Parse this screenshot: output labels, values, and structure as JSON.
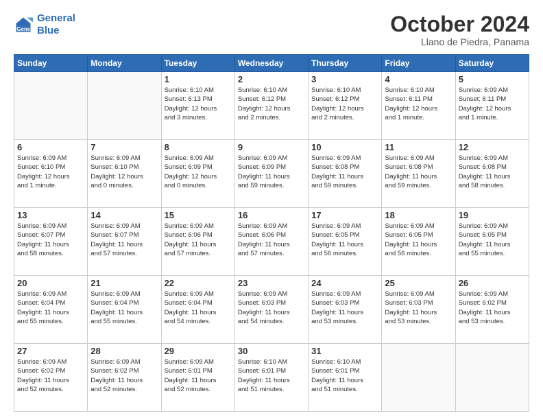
{
  "header": {
    "logo_line1": "General",
    "logo_line2": "Blue",
    "month_title": "October 2024",
    "location": "Llano de Piedra, Panama"
  },
  "weekdays": [
    "Sunday",
    "Monday",
    "Tuesday",
    "Wednesday",
    "Thursday",
    "Friday",
    "Saturday"
  ],
  "weeks": [
    [
      {
        "day": "",
        "info": ""
      },
      {
        "day": "",
        "info": ""
      },
      {
        "day": "1",
        "info": "Sunrise: 6:10 AM\nSunset: 6:13 PM\nDaylight: 12 hours\nand 3 minutes."
      },
      {
        "day": "2",
        "info": "Sunrise: 6:10 AM\nSunset: 6:12 PM\nDaylight: 12 hours\nand 2 minutes."
      },
      {
        "day": "3",
        "info": "Sunrise: 6:10 AM\nSunset: 6:12 PM\nDaylight: 12 hours\nand 2 minutes."
      },
      {
        "day": "4",
        "info": "Sunrise: 6:10 AM\nSunset: 6:11 PM\nDaylight: 12 hours\nand 1 minute."
      },
      {
        "day": "5",
        "info": "Sunrise: 6:09 AM\nSunset: 6:11 PM\nDaylight: 12 hours\nand 1 minute."
      }
    ],
    [
      {
        "day": "6",
        "info": "Sunrise: 6:09 AM\nSunset: 6:10 PM\nDaylight: 12 hours\nand 1 minute."
      },
      {
        "day": "7",
        "info": "Sunrise: 6:09 AM\nSunset: 6:10 PM\nDaylight: 12 hours\nand 0 minutes."
      },
      {
        "day": "8",
        "info": "Sunrise: 6:09 AM\nSunset: 6:09 PM\nDaylight: 12 hours\nand 0 minutes."
      },
      {
        "day": "9",
        "info": "Sunrise: 6:09 AM\nSunset: 6:09 PM\nDaylight: 11 hours\nand 59 minutes."
      },
      {
        "day": "10",
        "info": "Sunrise: 6:09 AM\nSunset: 6:08 PM\nDaylight: 11 hours\nand 59 minutes."
      },
      {
        "day": "11",
        "info": "Sunrise: 6:09 AM\nSunset: 6:08 PM\nDaylight: 11 hours\nand 59 minutes."
      },
      {
        "day": "12",
        "info": "Sunrise: 6:09 AM\nSunset: 6:08 PM\nDaylight: 11 hours\nand 58 minutes."
      }
    ],
    [
      {
        "day": "13",
        "info": "Sunrise: 6:09 AM\nSunset: 6:07 PM\nDaylight: 11 hours\nand 58 minutes."
      },
      {
        "day": "14",
        "info": "Sunrise: 6:09 AM\nSunset: 6:07 PM\nDaylight: 11 hours\nand 57 minutes."
      },
      {
        "day": "15",
        "info": "Sunrise: 6:09 AM\nSunset: 6:06 PM\nDaylight: 11 hours\nand 57 minutes."
      },
      {
        "day": "16",
        "info": "Sunrise: 6:09 AM\nSunset: 6:06 PM\nDaylight: 11 hours\nand 57 minutes."
      },
      {
        "day": "17",
        "info": "Sunrise: 6:09 AM\nSunset: 6:05 PM\nDaylight: 11 hours\nand 56 minutes."
      },
      {
        "day": "18",
        "info": "Sunrise: 6:09 AM\nSunset: 6:05 PM\nDaylight: 11 hours\nand 56 minutes."
      },
      {
        "day": "19",
        "info": "Sunrise: 6:09 AM\nSunset: 6:05 PM\nDaylight: 11 hours\nand 55 minutes."
      }
    ],
    [
      {
        "day": "20",
        "info": "Sunrise: 6:09 AM\nSunset: 6:04 PM\nDaylight: 11 hours\nand 55 minutes."
      },
      {
        "day": "21",
        "info": "Sunrise: 6:09 AM\nSunset: 6:04 PM\nDaylight: 11 hours\nand 55 minutes."
      },
      {
        "day": "22",
        "info": "Sunrise: 6:09 AM\nSunset: 6:04 PM\nDaylight: 11 hours\nand 54 minutes."
      },
      {
        "day": "23",
        "info": "Sunrise: 6:09 AM\nSunset: 6:03 PM\nDaylight: 11 hours\nand 54 minutes."
      },
      {
        "day": "24",
        "info": "Sunrise: 6:09 AM\nSunset: 6:03 PM\nDaylight: 11 hours\nand 53 minutes."
      },
      {
        "day": "25",
        "info": "Sunrise: 6:09 AM\nSunset: 6:03 PM\nDaylight: 11 hours\nand 53 minutes."
      },
      {
        "day": "26",
        "info": "Sunrise: 6:09 AM\nSunset: 6:02 PM\nDaylight: 11 hours\nand 53 minutes."
      }
    ],
    [
      {
        "day": "27",
        "info": "Sunrise: 6:09 AM\nSunset: 6:02 PM\nDaylight: 11 hours\nand 52 minutes."
      },
      {
        "day": "28",
        "info": "Sunrise: 6:09 AM\nSunset: 6:02 PM\nDaylight: 11 hours\nand 52 minutes."
      },
      {
        "day": "29",
        "info": "Sunrise: 6:09 AM\nSunset: 6:01 PM\nDaylight: 11 hours\nand 52 minutes."
      },
      {
        "day": "30",
        "info": "Sunrise: 6:10 AM\nSunset: 6:01 PM\nDaylight: 11 hours\nand 51 minutes."
      },
      {
        "day": "31",
        "info": "Sunrise: 6:10 AM\nSunset: 6:01 PM\nDaylight: 11 hours\nand 51 minutes."
      },
      {
        "day": "",
        "info": ""
      },
      {
        "day": "",
        "info": ""
      }
    ]
  ]
}
